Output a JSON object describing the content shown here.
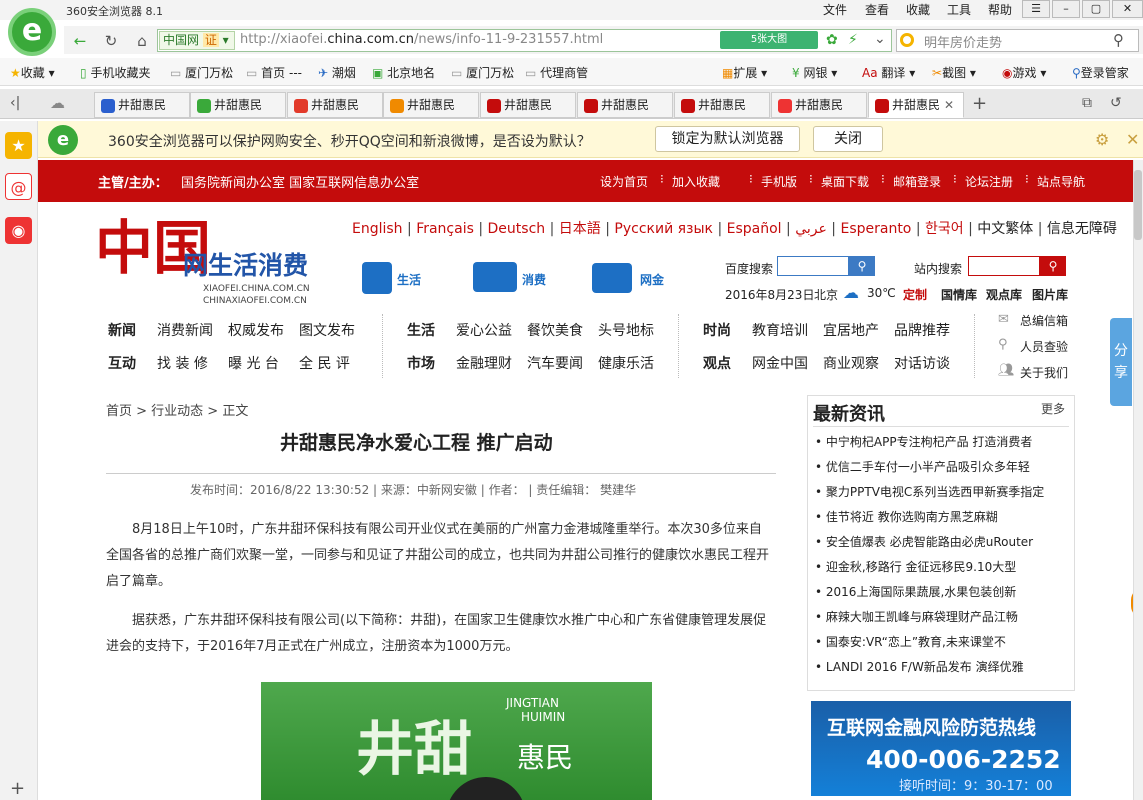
{
  "window": {
    "title": "360安全浏览器 8.1",
    "menus": [
      "文件",
      "查看",
      "收藏",
      "工具",
      "帮助"
    ]
  },
  "addressbar": {
    "cert_site": "中国网",
    "cert_badge": "证",
    "url_prefix": "http://xiaofei.",
    "url_domain": "china.com.cn",
    "url_path": "/news/info-11-9-231557.html",
    "image_button": "5张大图",
    "search_placeholder": "明年房价走势"
  },
  "favorites": {
    "items": [
      "收藏",
      "手机收藏夹",
      "厦门万松",
      "首页 ---",
      "潮烟",
      "北京地名",
      "厦门万松",
      "代理商管"
    ],
    "right_items": [
      "扩展",
      "网银",
      "翻译",
      "截图",
      "游戏",
      "登录管家"
    ]
  },
  "tabs": [
    {
      "label": "井甜惠民",
      "icon": "baidu-icon",
      "color": "#2b5fce"
    },
    {
      "label": "井甜惠民",
      "icon": "360-icon",
      "color": "#3aa93a"
    },
    {
      "label": "井甜惠民",
      "icon": "sogou-icon",
      "color": "#e23a2a"
    },
    {
      "label": "井甜惠民",
      "icon": "x-icon",
      "color": "#f08a00"
    },
    {
      "label": "井甜惠民",
      "icon": "china-icon",
      "color": "#c40c0c"
    },
    {
      "label": "井甜惠民",
      "icon": "chinanet-icon",
      "color": "#c40c0c"
    },
    {
      "label": "井甜惠民",
      "icon": "circle-icon",
      "color": "#c40c0c"
    },
    {
      "label": "井甜惠民",
      "icon": "weibo-icon",
      "color": "#e33"
    },
    {
      "label": "井甜惠民",
      "icon": "china-icon",
      "color": "#c40c0c"
    }
  ],
  "notice": {
    "text": "360安全浏览器可以保护网购安全、秒开QQ空间和新浪微博，是否设为默认？",
    "primary": "锁定为默认浏览器",
    "close": "关闭"
  },
  "redbar": {
    "left_label": "主管/主办：",
    "left_value": "国务院新闻办公室  国家互联网信息办公室",
    "links": [
      "设为首页",
      "加入收藏",
      "手机版",
      "桌面下载",
      "邮箱登录",
      "论坛注册",
      "站点导航"
    ]
  },
  "site": {
    "languages": [
      "English",
      "Français",
      "Deutsch",
      "日本語",
      "Русский язык",
      "Español",
      "عربي",
      "Esperanto",
      "한국어",
      "中文繁体",
      "信息无障碍"
    ],
    "logo_text": "网生活消费",
    "logo_sub1": "XIAOFEI.CHINA.COM.CN",
    "logo_sub2": "CHINAXIAOFEI.COM.CN",
    "channels": [
      "生活",
      "消费",
      "网金"
    ],
    "baidu_label": "百度搜索",
    "site_search_label": "站内搜索",
    "date": "2016年8月23日",
    "city": "北京",
    "temp": "30℃",
    "custom": "定制",
    "libs": [
      "国情库",
      "观点库",
      "图片库"
    ],
    "nav": {
      "row1": [
        "新闻",
        "消费新闻",
        "权威发布",
        "图文发布",
        "生活",
        "爱心公益",
        "餐饮美食",
        "头号地标",
        "时尚",
        "教育培训",
        "宜居地产",
        "品牌推荐"
      ],
      "row2": [
        "互动",
        "找 装 修",
        "曝 光 台",
        "全 民 评",
        "市场",
        "金融理财",
        "汽车要闻",
        "健康乐活",
        "观点",
        "网金中国",
        "商业观察",
        "对话访谈"
      ],
      "side": [
        "总编信箱",
        "人员查验",
        "关于我们"
      ]
    }
  },
  "article": {
    "breadcrumb": "首页 > 行业动态 > 正文",
    "title": "井甜惠民净水爱心工程 推广启动",
    "meta": "发布时间：2016/8/22 13:30:52  | 来源：中新网安徽  | 作者：  | 责任编辑：  樊建华",
    "p1": "8月18日上午10时，广东井甜环保科技有限公司开业仪式在美丽的广州富力金港城隆重举行。本次30多位来自全国各省的总推广商们欢聚一堂，一同参与和见证了井甜公司的成立，也共同为井甜公司推行的健康饮水惠民工程开启了篇章。",
    "p2": "据获悉，广东井甜环保科技有限公司(以下简称：井甜)，在国家卫生健康饮水推广中心和广东省健康管理发展促进会的支持下，于2016年7月正式在广州成立，注册资本为1000万元。",
    "image_text1": "井甜",
    "image_text2": "惠民",
    "image_en1": "JINGTIAN",
    "image_en2": "HUIMIN"
  },
  "news": {
    "heading": "最新资讯",
    "more": "更多",
    "items": [
      "中宁枸杞APP专注枸杞产品 打造消费者",
      "优信二手车付一小半产品吸引众多年轻",
      "聚力PPTV电视C系列当选西甲新赛季指定",
      "佳节将近 教你选购南方黑芝麻糊",
      "安全值爆表 必虎智能路由必虎uRouter",
      "迎金秋,移路行 金征远移民9.10大型",
      "2016上海国际果蔬展,水果包装创新",
      "麻辣大咖王凯峰与麻袋理财产品江畅",
      "国泰安:VR“恋上”教育,未来课堂不",
      "LANDI 2016 F/W新品发布 演绎优雅"
    ]
  },
  "hotline": {
    "title": "互联网金融风险防范热线",
    "number": "400-006-2252",
    "hours": "接听时间：9：30-17：00"
  },
  "share": {
    "label": "分享"
  }
}
